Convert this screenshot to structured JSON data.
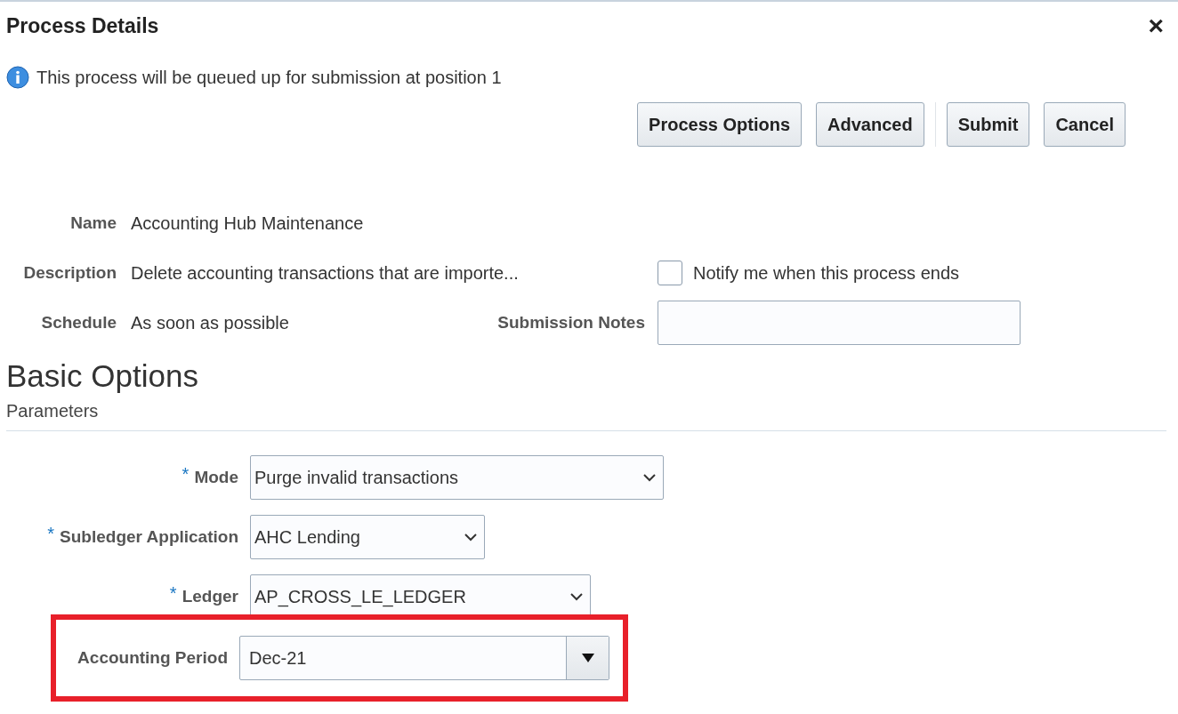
{
  "dialog": {
    "title": "Process Details",
    "close": "×"
  },
  "message": {
    "text": "This process will be queued up for submission at position 1"
  },
  "buttons": [
    {
      "label": "Process Options",
      "separator_before": false
    },
    {
      "label": "Advanced",
      "separator_before": false
    },
    {
      "label": "Submit",
      "separator_before": true
    },
    {
      "label": "Cancel",
      "separator_before": false
    }
  ],
  "details": {
    "name_label": "Name",
    "name": "Accounting Hub Maintenance",
    "description_label": "Description",
    "description": "Delete accounting transactions that are importe...",
    "schedule_label": "Schedule",
    "schedule": "As soon as possible"
  },
  "notify": {
    "label": "Notify me when this process ends",
    "checked": false
  },
  "submission_notes": {
    "label": "Submission Notes"
  },
  "section": {
    "title": "Basic Options",
    "subtitle": "Parameters"
  },
  "parameters": [
    {
      "label": "Mode",
      "marker": "*",
      "value": "Purge invalid transactions",
      "kind": "select",
      "highlighted": false
    },
    {
      "label": "Subledger Application",
      "marker": "*",
      "value": "AHC Lending",
      "kind": "select",
      "highlighted": false
    },
    {
      "label": "Ledger",
      "marker": "*",
      "value": "AP_CROSS_LE_LEDGER",
      "kind": "select",
      "highlighted": false
    },
    {
      "label": "Accounting Period",
      "value": "Dec-21",
      "kind": "combo",
      "highlighted": true
    }
  ]
}
